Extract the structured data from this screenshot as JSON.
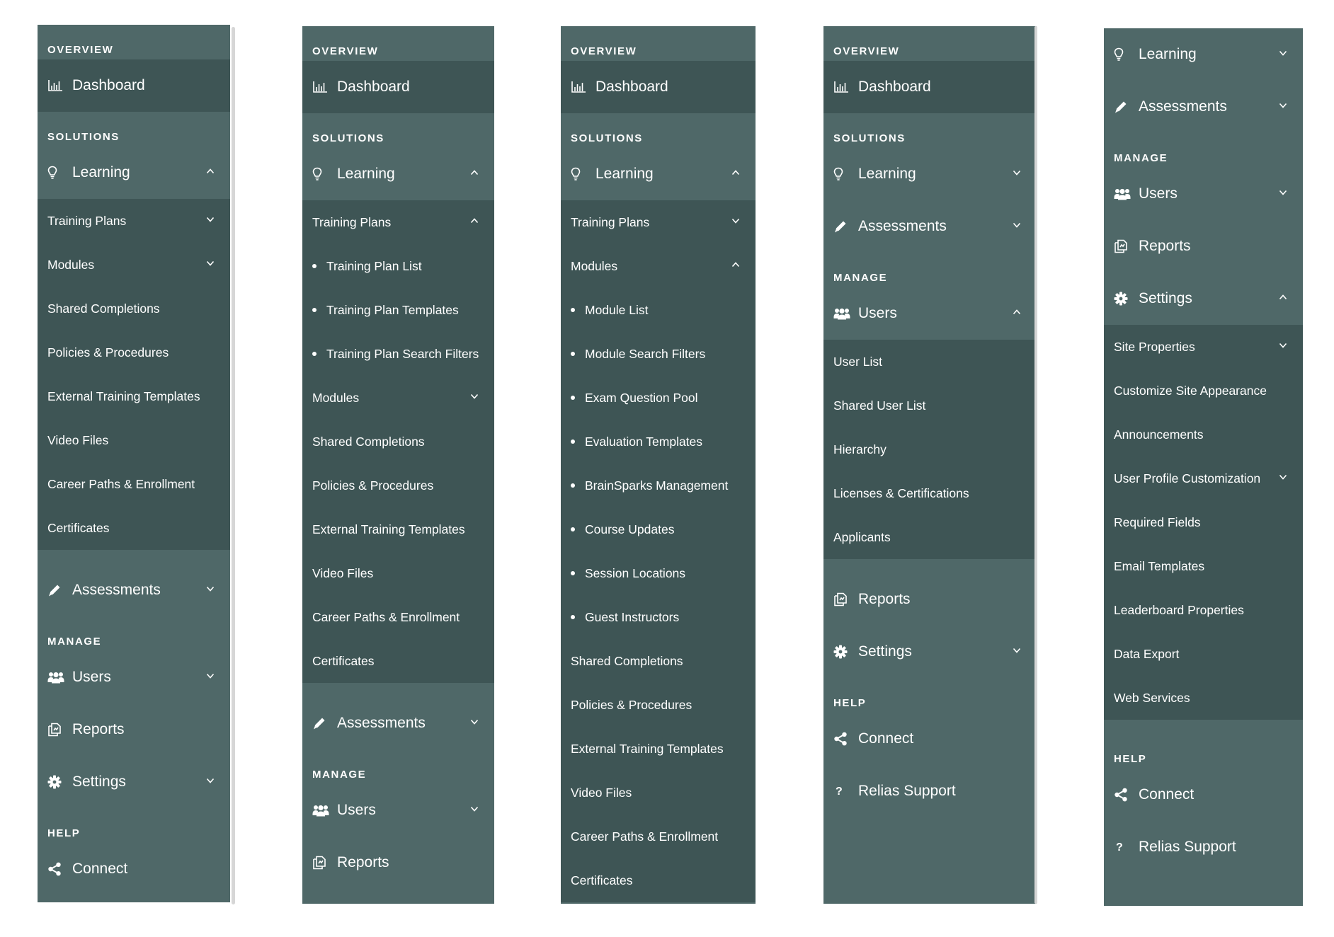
{
  "labels": {
    "overview": "OVERVIEW",
    "dashboard": "Dashboard",
    "solutions": "SOLUTIONS",
    "learning": "Learning",
    "training_plans": "Training Plans",
    "training_plan_list": "Training Plan List",
    "training_plan_templates": "Training Plan Templates",
    "training_plan_search_filters": "Training Plan Search Filters",
    "modules": "Modules",
    "module_list": "Module List",
    "module_search_filters": "Module Search Filters",
    "exam_question_pool": "Exam Question Pool",
    "evaluation_templates": "Evaluation Templates",
    "brainsparks_management": "BrainSparks Management",
    "course_updates": "Course Updates",
    "session_locations": "Session Locations",
    "guest_instructors": "Guest Instructors",
    "shared_completions": "Shared Completions",
    "policies_procedures": "Policies & Procedures",
    "external_training_templates": "External Training Templates",
    "video_files": "Video Files",
    "career_paths_enrollment": "Career Paths & Enrollment",
    "certificates": "Certificates",
    "assessments": "Assessments",
    "manage": "MANAGE",
    "users": "Users",
    "user_list": "User List",
    "shared_user_list": "Shared User List",
    "hierarchy": "Hierarchy",
    "licenses_certifications": "Licenses & Certifications",
    "applicants": "Applicants",
    "reports": "Reports",
    "settings": "Settings",
    "site_properties": "Site Properties",
    "customize_site_appearance": "Customize Site Appearance",
    "announcements": "Announcements",
    "user_profile_customization": "User Profile Customization",
    "required_fields": "Required Fields",
    "email_templates": "Email Templates",
    "leaderboard_properties": "Leaderboard Properties",
    "data_export": "Data Export",
    "web_services": "Web Services",
    "help": "HELP",
    "connect": "Connect",
    "relias_support": "Relias Support"
  },
  "icons": {
    "dashboard": "bar-chart-icon",
    "learning": "lightbulb-icon",
    "assessments": "pencil-icon",
    "users": "users-group-icon",
    "reports": "reports-icon",
    "settings": "gear-icon",
    "connect": "share-icon",
    "relias_support": "question-icon"
  },
  "colors": {
    "sidebar_bg": "#4f6868",
    "sidebar_active_bg": "#3e5555",
    "text": "#ffffff",
    "scrollbar": "#d6d6d6"
  },
  "panels": [
    {
      "id": "panel-1",
      "rows": [
        {
          "t": "section",
          "k": "overview"
        },
        {
          "t": "main",
          "k": "dashboard",
          "dark": true
        },
        {
          "t": "section",
          "k": "solutions"
        },
        {
          "t": "main",
          "k": "learning",
          "chev": "up"
        },
        {
          "t": "sub",
          "k": "training_plans",
          "chev": "down"
        },
        {
          "t": "sub",
          "k": "modules",
          "chev": "down"
        },
        {
          "t": "sub",
          "k": "shared_completions"
        },
        {
          "t": "sub",
          "k": "policies_procedures"
        },
        {
          "t": "sub",
          "k": "external_training_templates"
        },
        {
          "t": "sub",
          "k": "video_files"
        },
        {
          "t": "sub",
          "k": "career_paths_enrollment"
        },
        {
          "t": "sub",
          "k": "certificates"
        },
        {
          "t": "main",
          "k": "assessments",
          "chev": "down"
        },
        {
          "t": "section",
          "k": "manage"
        },
        {
          "t": "main",
          "k": "users",
          "chev": "down"
        },
        {
          "t": "main",
          "k": "reports"
        },
        {
          "t": "main",
          "k": "settings",
          "chev": "down"
        },
        {
          "t": "section",
          "k": "help"
        },
        {
          "t": "main",
          "k": "connect"
        }
      ]
    },
    {
      "id": "panel-2",
      "rows": [
        {
          "t": "section",
          "k": "overview"
        },
        {
          "t": "main",
          "k": "dashboard",
          "dark": true
        },
        {
          "t": "section",
          "k": "solutions"
        },
        {
          "t": "main",
          "k": "learning",
          "chev": "up"
        },
        {
          "t": "sub",
          "k": "training_plans",
          "chev": "up"
        },
        {
          "t": "sub",
          "k": "training_plan_list",
          "bullet": true
        },
        {
          "t": "sub",
          "k": "training_plan_templates",
          "bullet": true
        },
        {
          "t": "sub",
          "k": "training_plan_search_filters",
          "bullet": true
        },
        {
          "t": "sub",
          "k": "modules",
          "chev": "down"
        },
        {
          "t": "sub",
          "k": "shared_completions"
        },
        {
          "t": "sub",
          "k": "policies_procedures"
        },
        {
          "t": "sub",
          "k": "external_training_templates"
        },
        {
          "t": "sub",
          "k": "video_files"
        },
        {
          "t": "sub",
          "k": "career_paths_enrollment"
        },
        {
          "t": "sub",
          "k": "certificates"
        },
        {
          "t": "main",
          "k": "assessments",
          "chev": "down"
        },
        {
          "t": "section",
          "k": "manage"
        },
        {
          "t": "main",
          "k": "users",
          "chev": "down"
        },
        {
          "t": "main",
          "k": "reports"
        }
      ]
    },
    {
      "id": "panel-3",
      "rows": [
        {
          "t": "section",
          "k": "overview"
        },
        {
          "t": "main",
          "k": "dashboard",
          "dark": true
        },
        {
          "t": "section",
          "k": "solutions"
        },
        {
          "t": "main",
          "k": "learning",
          "chev": "up"
        },
        {
          "t": "sub",
          "k": "training_plans",
          "chev": "down"
        },
        {
          "t": "sub",
          "k": "modules",
          "chev": "up"
        },
        {
          "t": "sub",
          "k": "module_list",
          "bullet": true
        },
        {
          "t": "sub",
          "k": "module_search_filters",
          "bullet": true
        },
        {
          "t": "sub",
          "k": "exam_question_pool",
          "bullet": true
        },
        {
          "t": "sub",
          "k": "evaluation_templates",
          "bullet": true
        },
        {
          "t": "sub",
          "k": "brainsparks_management",
          "bullet": true
        },
        {
          "t": "sub",
          "k": "course_updates",
          "bullet": true
        },
        {
          "t": "sub",
          "k": "session_locations",
          "bullet": true
        },
        {
          "t": "sub",
          "k": "guest_instructors",
          "bullet": true
        },
        {
          "t": "sub",
          "k": "shared_completions"
        },
        {
          "t": "sub",
          "k": "policies_procedures"
        },
        {
          "t": "sub",
          "k": "external_training_templates"
        },
        {
          "t": "sub",
          "k": "video_files"
        },
        {
          "t": "sub",
          "k": "career_paths_enrollment"
        },
        {
          "t": "sub",
          "k": "certificates"
        }
      ]
    },
    {
      "id": "panel-4",
      "rows": [
        {
          "t": "section",
          "k": "overview"
        },
        {
          "t": "main",
          "k": "dashboard",
          "dark": true
        },
        {
          "t": "section",
          "k": "solutions"
        },
        {
          "t": "main",
          "k": "learning",
          "chev": "down"
        },
        {
          "t": "main",
          "k": "assessments",
          "chev": "down"
        },
        {
          "t": "section",
          "k": "manage"
        },
        {
          "t": "main",
          "k": "users",
          "chev": "up"
        },
        {
          "t": "sub",
          "k": "user_list"
        },
        {
          "t": "sub",
          "k": "shared_user_list"
        },
        {
          "t": "sub",
          "k": "hierarchy"
        },
        {
          "t": "sub",
          "k": "licenses_certifications"
        },
        {
          "t": "sub",
          "k": "applicants"
        },
        {
          "t": "main",
          "k": "reports"
        },
        {
          "t": "main",
          "k": "settings",
          "chev": "down"
        },
        {
          "t": "section",
          "k": "help"
        },
        {
          "t": "main",
          "k": "connect"
        },
        {
          "t": "main",
          "k": "relias_support"
        }
      ]
    },
    {
      "id": "panel-5",
      "rows": [
        {
          "t": "main",
          "k": "learning",
          "chev": "down"
        },
        {
          "t": "main",
          "k": "assessments",
          "chev": "down"
        },
        {
          "t": "section",
          "k": "manage"
        },
        {
          "t": "main",
          "k": "users",
          "chev": "down"
        },
        {
          "t": "main",
          "k": "reports"
        },
        {
          "t": "main",
          "k": "settings",
          "chev": "up"
        },
        {
          "t": "sub",
          "k": "site_properties",
          "chev": "down"
        },
        {
          "t": "sub",
          "k": "customize_site_appearance"
        },
        {
          "t": "sub",
          "k": "announcements"
        },
        {
          "t": "sub",
          "k": "user_profile_customization",
          "chev": "down"
        },
        {
          "t": "sub",
          "k": "required_fields"
        },
        {
          "t": "sub",
          "k": "email_templates"
        },
        {
          "t": "sub",
          "k": "leaderboard_properties"
        },
        {
          "t": "sub",
          "k": "data_export"
        },
        {
          "t": "sub",
          "k": "web_services"
        },
        {
          "t": "section",
          "k": "help"
        },
        {
          "t": "main",
          "k": "connect"
        },
        {
          "t": "main",
          "k": "relias_support"
        }
      ]
    }
  ]
}
